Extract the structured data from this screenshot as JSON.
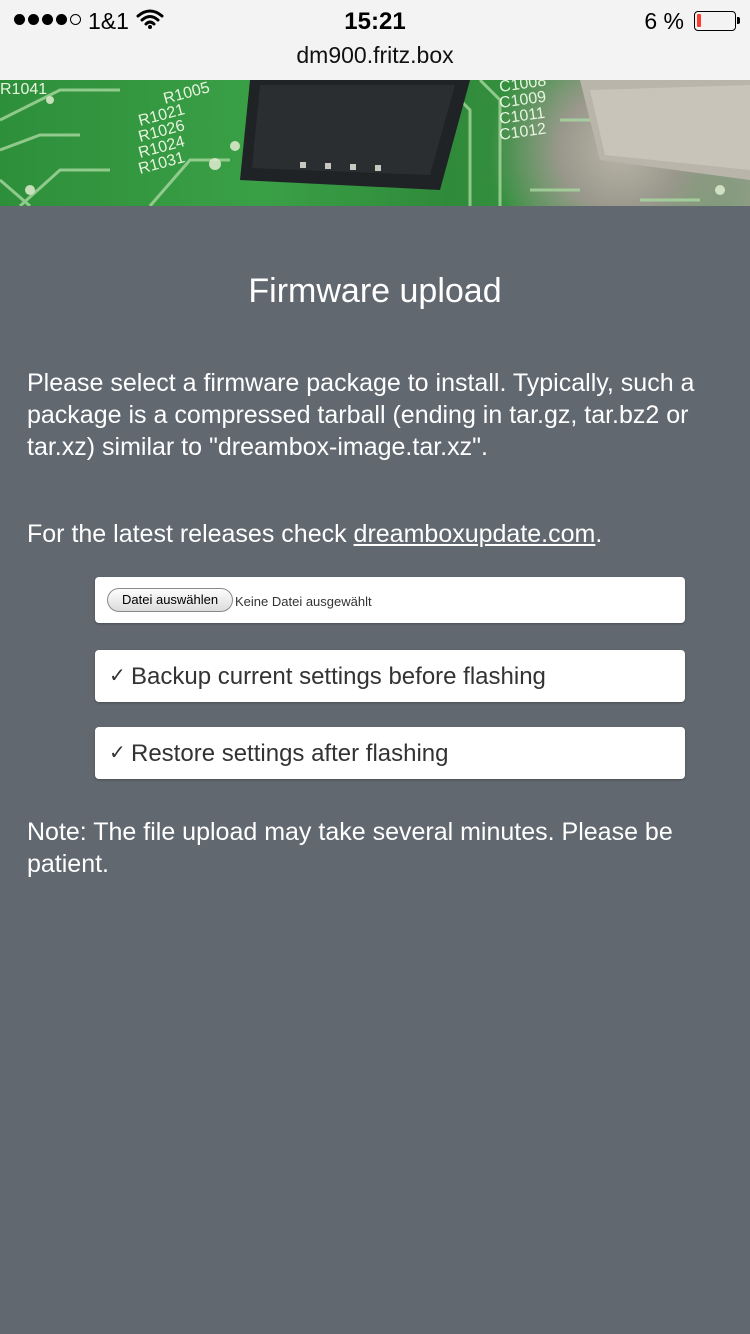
{
  "status_bar": {
    "carrier": "1&1",
    "time": "15:21",
    "battery": "6 %"
  },
  "browser": {
    "url": "dm900.fritz.box"
  },
  "page": {
    "title": "Firmware upload",
    "intro": "Please select a firmware package to install. Typically, such a package is a compressed tarball (ending in tar.gz, tar.bz2 or tar.xz) similar to \"dreambox-image.tar.xz\".",
    "latest_prefix": "For the latest releases check ",
    "latest_link": "dreamboxupdate.com",
    "latest_suffix": ".",
    "file_button": "Datei auswählen",
    "file_status": "Keine Datei ausgewählt",
    "options": [
      {
        "label": "Backup current settings before flashing",
        "checked": true
      },
      {
        "label": "Restore settings after flashing",
        "checked": true
      }
    ],
    "note": "Note: The file upload may take several minutes. Please be patient."
  },
  "banner_labels": [
    "R1041",
    "R1005",
    "R1021",
    "R1026",
    "R1024",
    "R1031",
    "C1008",
    "C1009",
    "C1011",
    "C1012"
  ],
  "colors": {
    "background": "#626870",
    "battery_low": "#ff3b30"
  }
}
